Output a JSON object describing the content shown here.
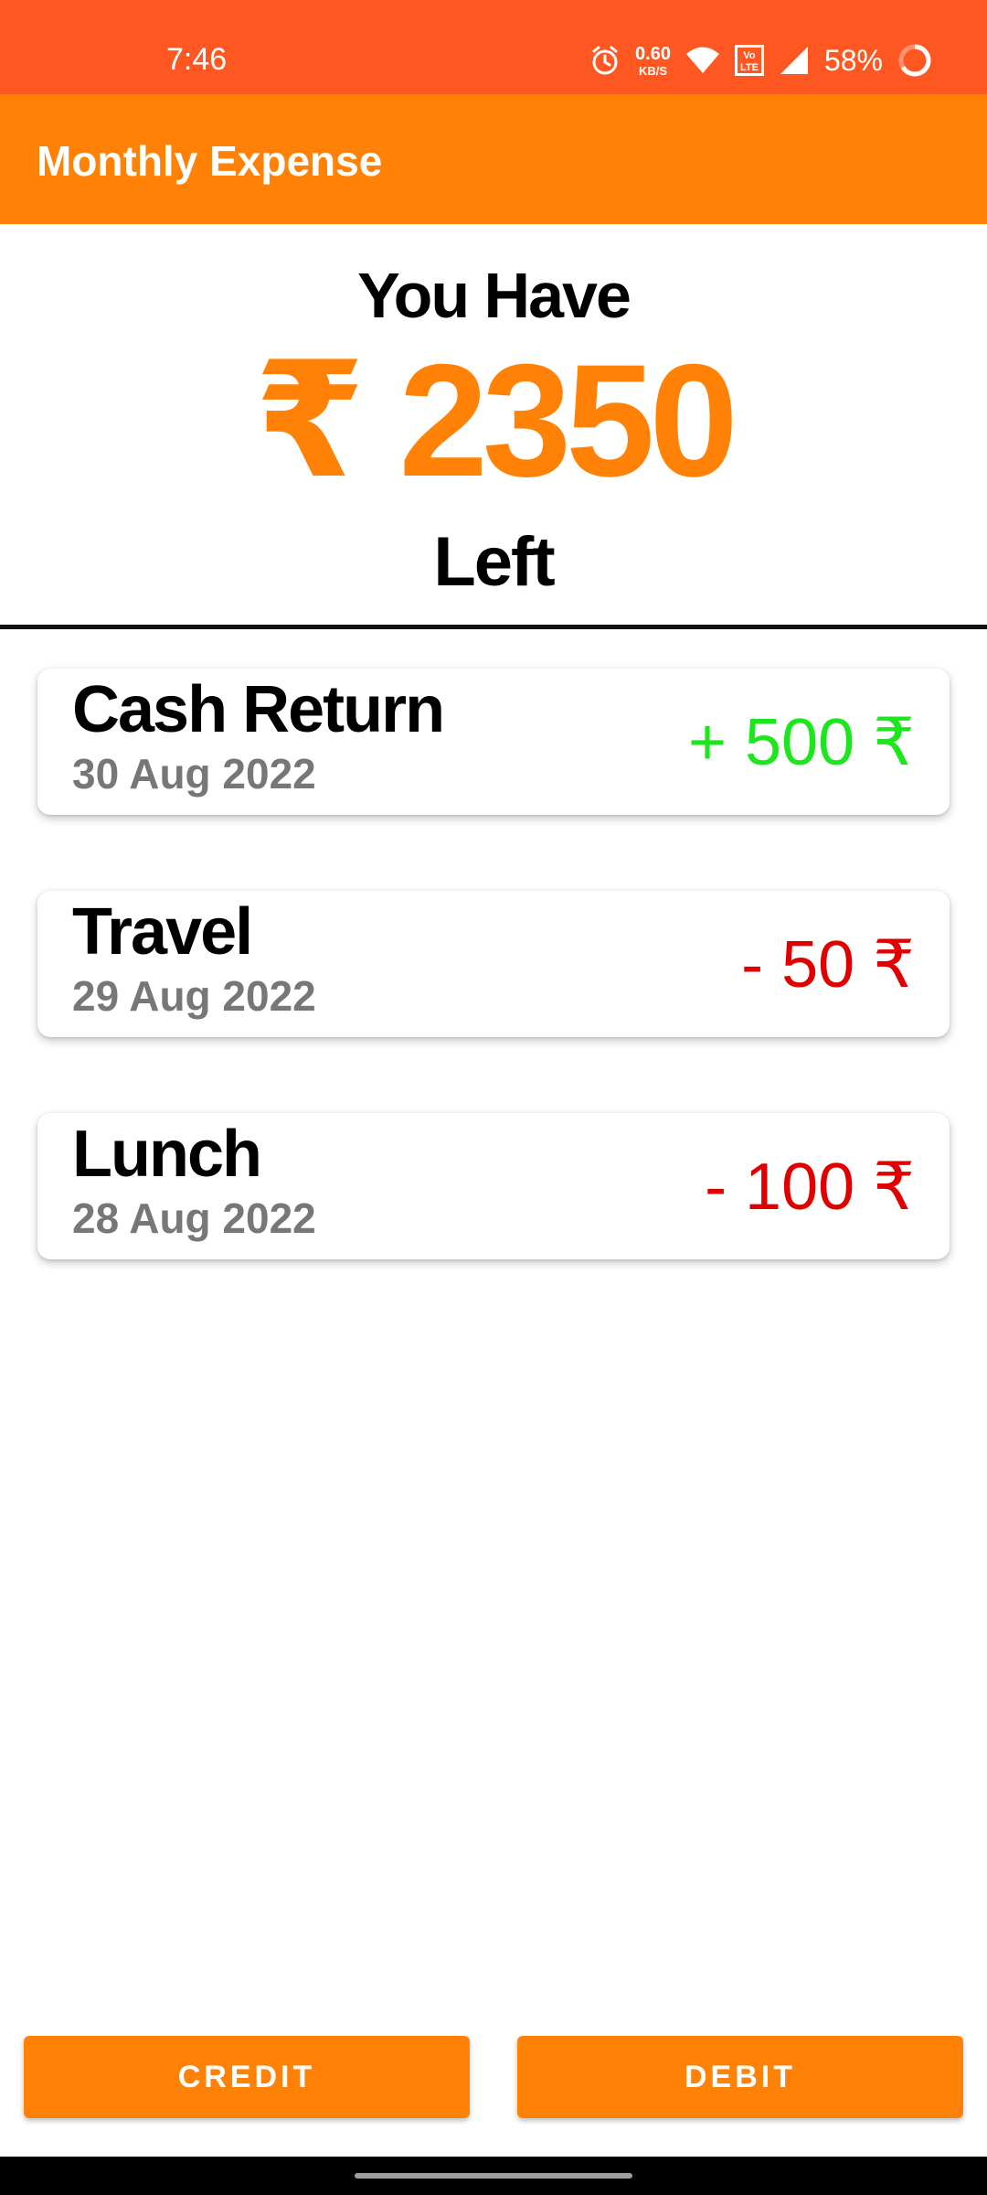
{
  "status_bar": {
    "time": "7:46",
    "net_speed_value": "0.60",
    "net_speed_unit": "KB/S",
    "battery_percent": "58%",
    "background_color": "#ff5722",
    "icons": [
      "alarm-icon",
      "wifi-icon",
      "volte-icon",
      "signal-icon",
      "battery-ring-icon"
    ]
  },
  "app_bar": {
    "title": "Monthly Expense",
    "background_color": "#ff8207"
  },
  "summary": {
    "heading": "You Have",
    "balance": "₹ 2350",
    "suffix": "Left",
    "balance_color": "#ff8207"
  },
  "transactions": [
    {
      "title": "Cash Return",
      "date": "30 Aug 2022",
      "amount": "+ 500 ₹",
      "type": "credit",
      "color": "#1ee61e"
    },
    {
      "title": "Travel",
      "date": "29 Aug 2022",
      "amount": "- 50 ₹",
      "type": "debit",
      "color": "#e00000"
    },
    {
      "title": "Lunch",
      "date": "28 Aug 2022",
      "amount": "- 100 ₹",
      "type": "debit",
      "color": "#e00000"
    }
  ],
  "actions": {
    "credit_label": "CREDIT",
    "debit_label": "DEBIT"
  }
}
